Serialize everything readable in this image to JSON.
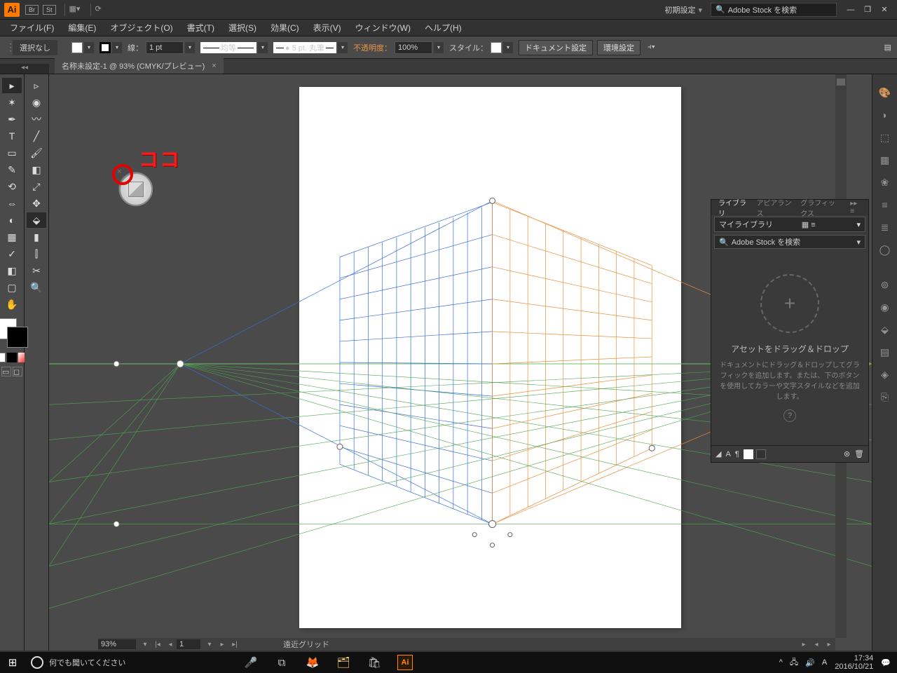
{
  "titlebar": {
    "preset": "初期設定",
    "stock_placeholder": "Adobe Stock を検索"
  },
  "menu": {
    "file": "ファイル(F)",
    "edit": "編集(E)",
    "object": "オブジェクト(O)",
    "type": "書式(T)",
    "select": "選択(S)",
    "effect": "効果(C)",
    "view": "表示(V)",
    "window": "ウィンドウ(W)",
    "help": "ヘルプ(H)"
  },
  "ctrl": {
    "selection": "選択なし",
    "stroke_label": "線：",
    "stroke_width": "1 pt",
    "profile_label": "均等",
    "brush_label": "5 pt. 丸筆",
    "opacity_label": "不透明度：",
    "opacity_value": "100%",
    "style_label": "スタイル：",
    "doc_setup": "ドキュメント設定",
    "prefs": "環境設定"
  },
  "doc": {
    "tab": "名称未設定-1 @ 93% (CMYK/プレビュー)"
  },
  "status": {
    "zoom": "93%",
    "page": "1",
    "tool": "遠近グリッド"
  },
  "panel": {
    "tab1": "ライブラリ",
    "tab2": "アピアランス",
    "tab3": "グラフィックス",
    "dd": "マイライブラリ",
    "search": "Adobe Stock を検索",
    "drop_title": "アセットをドラッグ＆ドロップ",
    "drop_desc": "ドキュメントにドラッグ＆ドロップしてグラフィックを追加します。または、下のボタンを使用してカラーや文字スタイルなどを追加します。"
  },
  "annot": {
    "label": "ココ"
  },
  "taskbar": {
    "cortana": "何でも聞いてください",
    "time": "17:34",
    "date": "2016/10/21"
  }
}
